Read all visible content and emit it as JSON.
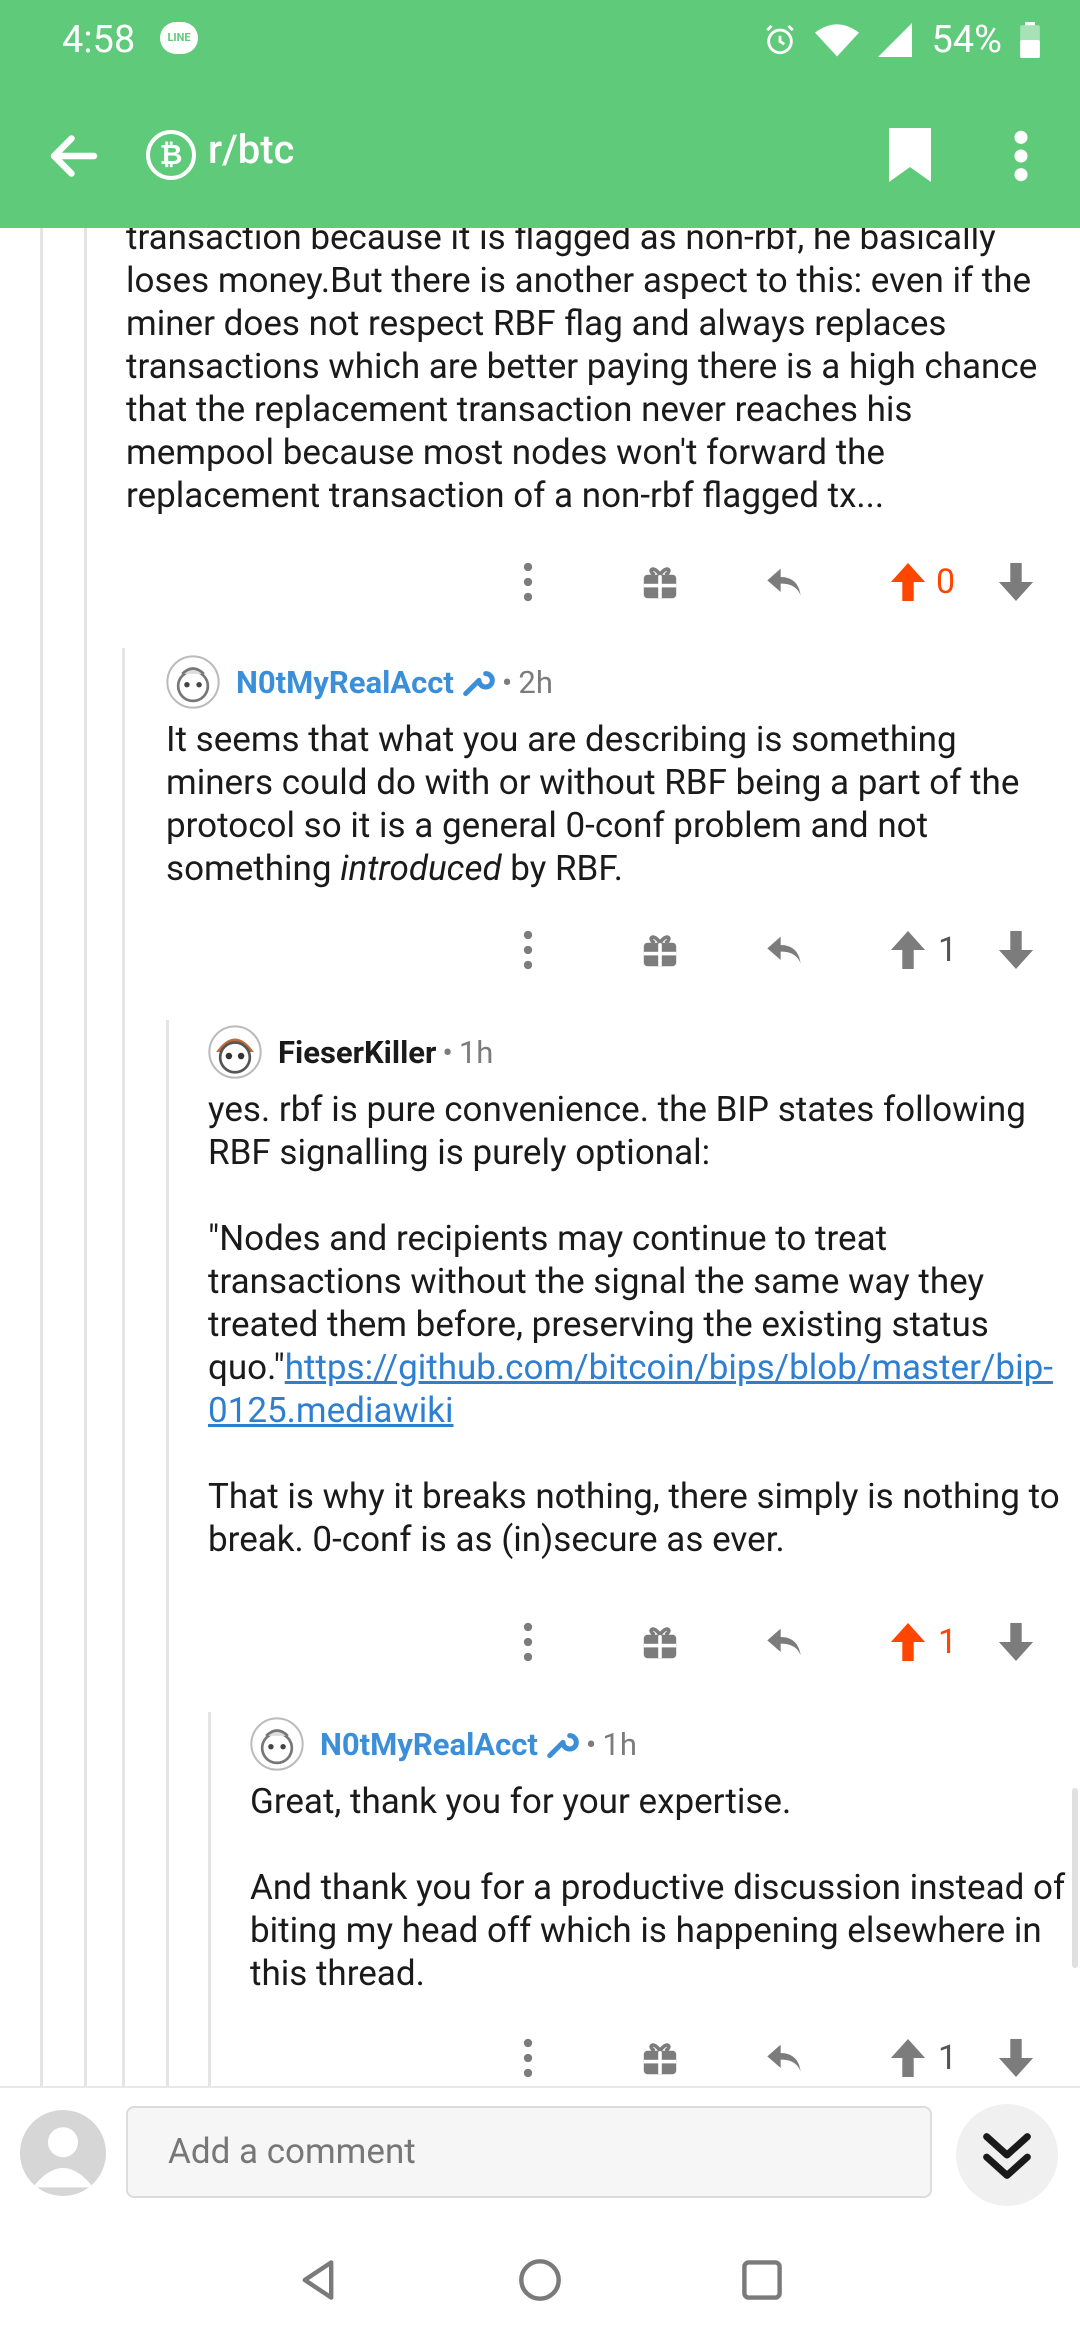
{
  "status_bar": {
    "time": "4:58",
    "line_badge": "LINE",
    "battery": "54%"
  },
  "toolbar": {
    "subreddit": "r/btc",
    "btc_symbol": "₿"
  },
  "comments": [
    {
      "body_paragraphs": [
        "transaction because it is flagged as non-rbf, he basically loses money.But there is another aspect to this: even if the miner does not respect RBF flag and always replaces transactions which are better paying there is a high chance that the replacement transaction never reaches his mempool because most nodes won't forward the replacement transaction of a non-rbf flagged tx..."
      ],
      "votes": "0",
      "upvoted": true
    },
    {
      "author": "N0tMyRealAcct",
      "time": "2h",
      "body_part1": "It seems that what you are describing is something miners could do with or without RBF being a part of the protocol so it is a general 0-conf problem and not something ",
      "body_italic": "introduced",
      "body_part2": " by RBF.",
      "votes": "1",
      "upvoted": false
    },
    {
      "author": "FieserKiller",
      "time": "1h",
      "para1": "yes. rbf is pure convenience. the BIP states following RBF signalling is purely optional:",
      "para2_text": "\"Nodes and recipients may continue to treat transactions without the signal the same way they treated them before, preserving the existing status quo.\"",
      "para2_link": "https://github.com/bitcoin/bips/blob/master/bip-0125.mediawiki",
      "para3": "That is why it breaks nothing, there simply is nothing to break. 0-conf is as (in)secure as ever.",
      "votes": "1",
      "upvoted": true
    },
    {
      "author": "N0tMyRealAcct",
      "time": "1h",
      "para1": "Great, thank you for your expertise.",
      "para2": "And thank you for a productive discussion instead of biting my head off which is happening elsewhere in this thread.",
      "votes": "1",
      "upvoted": false
    }
  ],
  "comment_bar": {
    "placeholder": "Add a comment"
  },
  "colors": {
    "brand_green": "#5fca7a",
    "upvote": "#ff4500",
    "username_blue": "#3a8fd8",
    "link": "#2f7fd1"
  }
}
